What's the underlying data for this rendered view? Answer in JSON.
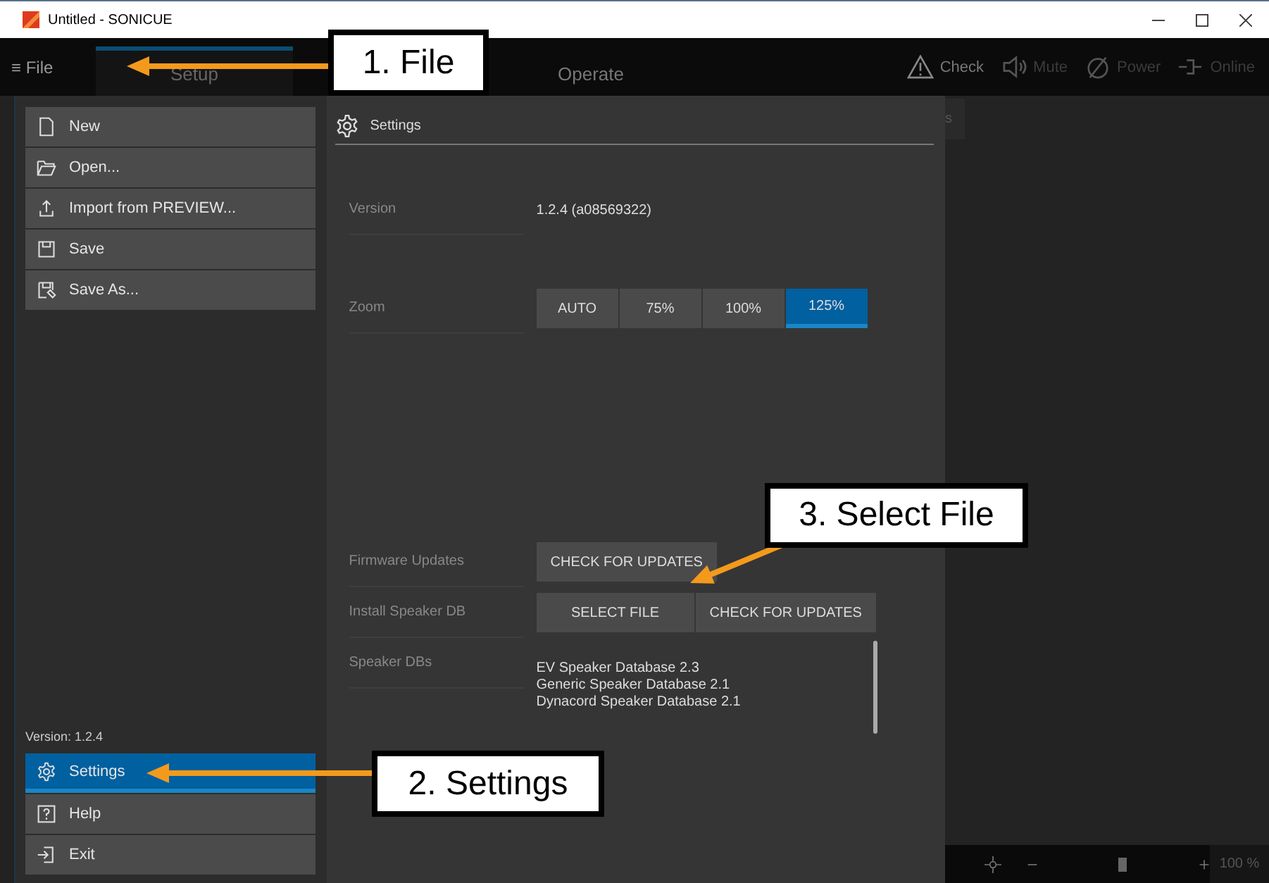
{
  "window": {
    "title": "Untitled - SONICUE",
    "controls": [
      {
        "kind": "minimize"
      },
      {
        "kind": "maximize"
      },
      {
        "kind": "close"
      }
    ]
  },
  "topbar": {
    "menu_glyph": "≡",
    "file_label": "File",
    "tabs": [
      {
        "label": "Setup",
        "selected": true
      },
      {
        "label": "Operate",
        "selected": false
      }
    ],
    "actions": [
      {
        "kind": "warning",
        "label": "Check"
      },
      {
        "kind": "speaker",
        "label": "Mute"
      },
      {
        "kind": "power",
        "label": "Power"
      },
      {
        "kind": "plug",
        "label": "Online"
      }
    ]
  },
  "file_menu": {
    "items": [
      {
        "kind": "new",
        "label": "New"
      },
      {
        "kind": "open",
        "label": "Open..."
      },
      {
        "kind": "import",
        "label": "Import from PREVIEW..."
      },
      {
        "kind": "save",
        "label": "Save"
      },
      {
        "kind": "saveas",
        "label": "Save As..."
      }
    ],
    "version": "Version: 1.2.4",
    "bottom_items": [
      {
        "kind": "settings",
        "label": "Settings",
        "selected": true
      },
      {
        "kind": "help",
        "label": "Help",
        "selected": false
      },
      {
        "kind": "exit",
        "label": "Exit",
        "selected": false
      }
    ]
  },
  "settings": {
    "title": "Settings",
    "rows": [
      {
        "kind": "text",
        "label": "Version",
        "value": "1.2.4 (a08569322)"
      },
      {
        "kind": "options",
        "label": "Zoom",
        "options": [
          {
            "label": "AUTO",
            "selected": false
          },
          {
            "label": "75%",
            "selected": false
          },
          {
            "label": "100%",
            "selected": false
          },
          {
            "label": "125%",
            "selected": true
          }
        ]
      },
      {
        "kind": "buttons",
        "label": "Firmware Updates",
        "buttons": [
          "CHECK FOR UPDATES"
        ]
      },
      {
        "kind": "buttons",
        "label": "Install Speaker DB",
        "buttons": [
          "SELECT FILE",
          "CHECK FOR UPDATES"
        ]
      },
      {
        "kind": "list",
        "label": "Speaker DBs",
        "items": [
          "EV Speaker Database 2.3",
          "Generic Speaker Database 2.1",
          "Dynacord Speaker Database 2.1"
        ]
      }
    ]
  },
  "background": {
    "tab_fragment": "s",
    "zoom_reading": "100 %",
    "zoom_slider": {
      "level": 0.57
    }
  },
  "annotations": [
    {
      "text": "1. File"
    },
    {
      "text": "2. Settings"
    },
    {
      "text": "3. Select File"
    }
  ]
}
